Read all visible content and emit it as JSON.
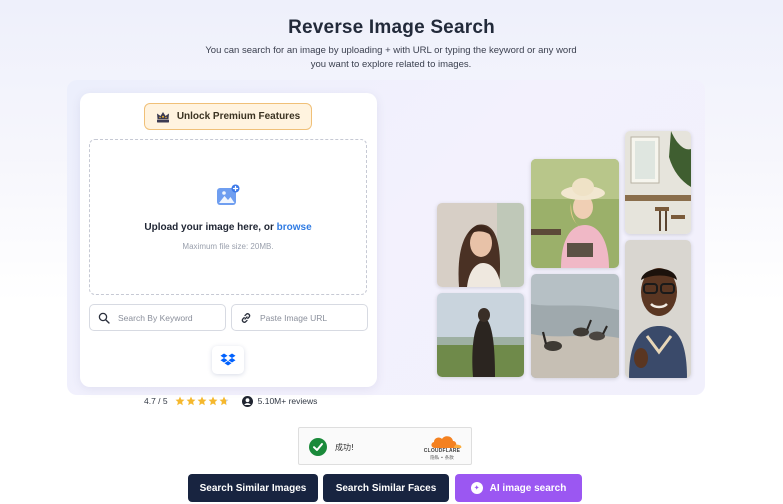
{
  "header": {
    "title": "Reverse Image Search",
    "subtitle_line1": "You can search for an image by uploading + with URL or typing the keyword or any word",
    "subtitle_line2": "you want to explore related to images."
  },
  "upload": {
    "premium_label": "Unlock Premium Features",
    "upload_text": "Upload your image here, or ",
    "browse_label": "browse",
    "hint": "Maximum file size: 20MB.",
    "keyword_placeholder": "Search By Keyword",
    "url_placeholder": "Paste Image URL"
  },
  "rating": {
    "score": "4.7 / 5",
    "stars": 4.7,
    "reviews": "5.10M+ reviews"
  },
  "captcha": {
    "status": "成功!",
    "brand": "CLOUDFLARE",
    "links": "隐私 • 条款"
  },
  "actions": {
    "search_similar_images": "Search Similar Images",
    "search_similar_faces": "Search Similar Faces",
    "ai_image_search": "AI image search"
  },
  "icons": {
    "premium": "crown-icon",
    "upload": "image-upload-icon",
    "search": "search-icon",
    "link": "link-icon",
    "dropbox": "dropbox-icon",
    "star": "star-icon",
    "user": "user-icon",
    "check": "check-icon",
    "ai": "ai-icon"
  },
  "colors": {
    "accent_blue": "#2f7be3",
    "dark_button": "#182440",
    "purple_button": "#9b57f2",
    "star": "#f5b82e",
    "premium_bg": "#fff3df"
  }
}
